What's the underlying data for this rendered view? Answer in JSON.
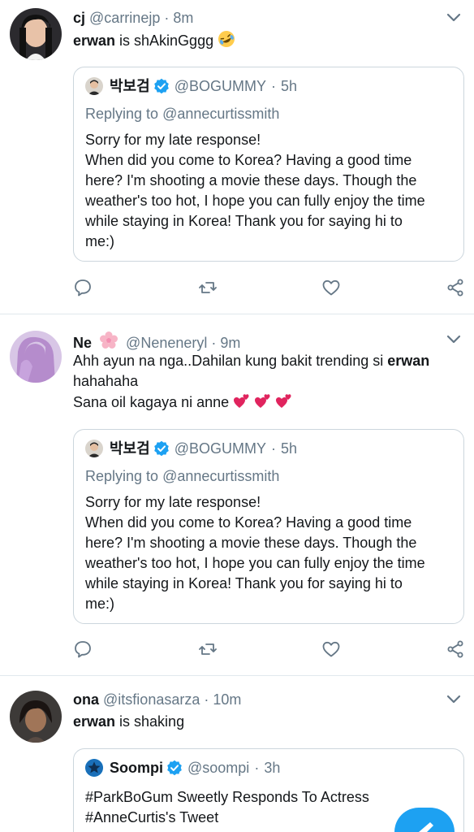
{
  "colors": {
    "accent": "#1da1f2",
    "text": "#14171a",
    "muted": "#657786",
    "border": "#ccd6dd",
    "heart_emoji": "#e0245e"
  },
  "tweets": [
    {
      "display_name": "cj",
      "handle": "@carrinejp",
      "dot": "·",
      "time": "8m",
      "text_bold": "erwan",
      "text_rest": " is shAkinGggg",
      "emoji": "rolling-on-floor-laughing-emoji",
      "quote": {
        "name": "박보검",
        "handle": "@BOGUMMY",
        "dot": "·",
        "time": "5h",
        "reply_prefix": "Replying to ",
        "reply_mention": "@annecurtissmith",
        "lines": [
          "Sorry for my late response!",
          "When did you come to Korea? Having a good time",
          "here? I'm shooting a movie these days. Though the",
          "weather's too hot, I hope you can fully enjoy the time",
          "while staying in Korea! Thank you for saying hi to",
          "me:)"
        ]
      }
    },
    {
      "display_name": "Ne",
      "handle": "@Neneneryl",
      "dot": "·",
      "time": "9m",
      "line1": "Ahh ayun na nga..Dahilan kung bakit trending si ",
      "line1_bold": "erwan",
      "line2": "hahahaha",
      "line3": "Sana oil kagaya ni anne",
      "quote": {
        "name": "박보검",
        "handle": "@BOGUMMY",
        "dot": "·",
        "time": "5h",
        "reply_prefix": "Replying to ",
        "reply_mention": "@annecurtissmith",
        "lines": [
          "Sorry for my late response!",
          "When did you come to Korea? Having a good time",
          "here? I'm shooting a movie these days. Though the",
          "weather's too hot, I hope you can fully enjoy the time",
          "while staying in Korea! Thank you for saying hi to",
          "me:)"
        ]
      }
    },
    {
      "display_name": "ona",
      "handle": "@itsfionasarza",
      "dot": "·",
      "time": "10m",
      "text_bold": "erwan",
      "text_rest": " is shaking",
      "quote": {
        "name": "Soompi",
        "handle": "@soompi",
        "dot": "·",
        "time": "3h",
        "lines": [
          "#ParkBoGum Sweetly Responds To Actress",
          "#AnneCurtis's Tweet"
        ]
      }
    }
  ]
}
